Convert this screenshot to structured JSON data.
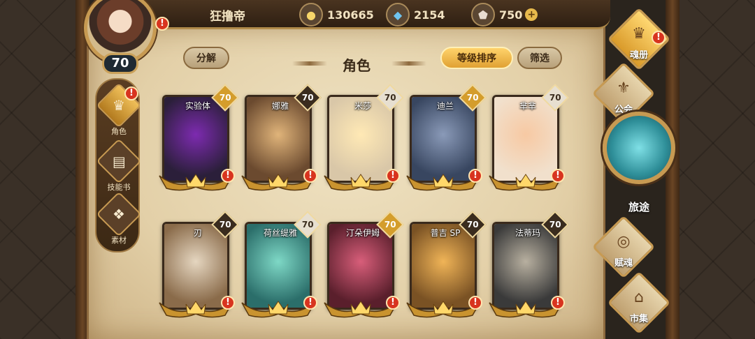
{
  "player": {
    "name": "狂撸帝",
    "level": "70"
  },
  "resources": {
    "gold": "130665",
    "crystal": "2154",
    "diamond": "750",
    "plus_label": "+"
  },
  "alert_mark": "!",
  "toolbar": {
    "decompose_label": "分解",
    "title": "角色",
    "sort_label": "等级排序",
    "filter_label": "筛选"
  },
  "sidebar": {
    "items": [
      {
        "label": "角色",
        "icon": "character-icon",
        "active": true
      },
      {
        "label": "技能书",
        "icon": "skill-book-icon",
        "active": false
      },
      {
        "label": "素材",
        "icon": "material-icon",
        "active": false
      }
    ]
  },
  "cards": [
    {
      "name": "实验体",
      "level": "70",
      "badge": "gold",
      "color_a": "#2b1f3a",
      "color_b": "#7d2bb0"
    },
    {
      "name": "娜雅",
      "level": "70",
      "badge": "dark",
      "color_a": "#6b4a2f",
      "color_b": "#e0b47a"
    },
    {
      "name": "米莎",
      "level": "70",
      "badge": "light",
      "color_a": "#d9c7a8",
      "color_b": "#ffe9b5"
    },
    {
      "name": "迪兰",
      "level": "70",
      "badge": "gold",
      "color_a": "#384660",
      "color_b": "#8a9ab8"
    },
    {
      "name": "芈芈",
      "level": "70",
      "badge": "light",
      "color_a": "#f1e0cc",
      "color_b": "#f7c9a3"
    },
    {
      "name": "刃",
      "level": "70",
      "badge": "dark",
      "color_a": "#8a6b4a",
      "color_b": "#e5d6c0"
    },
    {
      "name": "荷丝缇雅",
      "level": "70",
      "badge": "light",
      "color_a": "#2b6e6a",
      "color_b": "#7ed8c6"
    },
    {
      "name": "汀朵伊姆",
      "level": "70",
      "badge": "gold",
      "color_a": "#5a1f2c",
      "color_b": "#d85e7a"
    },
    {
      "name": "普吉 SP",
      "level": "70",
      "badge": "dark",
      "color_a": "#7a5224",
      "color_b": "#f0b457"
    },
    {
      "name": "法蒂玛",
      "level": "70",
      "badge": "dark",
      "color_a": "#3a3a3a",
      "color_b": "#b8b0a0"
    }
  ],
  "right_nav": {
    "soul_book": "魂册",
    "guild": "公会",
    "journey": "旅途",
    "talent": "赋魂",
    "market": "市集"
  }
}
